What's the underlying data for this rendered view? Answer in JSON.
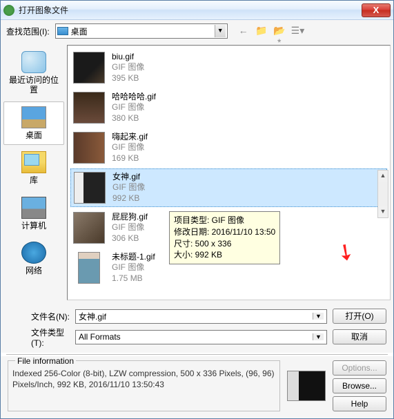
{
  "title": "打开图象文件",
  "toolbar": {
    "lookin_label": "查找范围(I):",
    "lookin_value": "桌面"
  },
  "nav": {
    "back": "←",
    "up": "📁",
    "newfolder": "📂*",
    "views": "☰▾"
  },
  "sidebar": {
    "items": [
      {
        "label": "最近访问的位置"
      },
      {
        "label": "桌面"
      },
      {
        "label": "库"
      },
      {
        "label": "计算机"
      },
      {
        "label": "网络"
      }
    ]
  },
  "files": [
    {
      "name": "biu.gif",
      "type": "GIF 图像",
      "size": "395 KB",
      "thumb": "th-biu"
    },
    {
      "name": "哈哈哈哈.gif",
      "type": "GIF 图像",
      "size": "380 KB",
      "thumb": "th-haha"
    },
    {
      "name": "嗨起来.gif",
      "type": "GIF 图像",
      "size": "169 KB",
      "thumb": "th-hai"
    },
    {
      "name": "女神.gif",
      "type": "GIF 图像",
      "size": "992 KB",
      "thumb": "th-nvshen",
      "selected": true
    },
    {
      "name": "屁屁狗.gif",
      "type": "GIF 图像",
      "size": "306 KB",
      "thumb": "th-pipi"
    },
    {
      "name": "未标题-1.gif",
      "type": "GIF 图像",
      "size": "1.75 MB",
      "thumb": "th-weibiao"
    }
  ],
  "tooltip": {
    "l1": "项目类型: GIF 图像",
    "l2": "修改日期: 2016/11/10 13:50",
    "l3": "尺寸: 500 x 336",
    "l4": "大小: 992 KB"
  },
  "form": {
    "filename_label": "文件名(N):",
    "filename_value": "女神.gif",
    "filetype_label": "文件类型(T):",
    "filetype_value": "All Formats",
    "open": "打开(O)",
    "cancel": "取消"
  },
  "fileinfo": {
    "legend": "File information",
    "text": "Indexed 256-Color (8-bit),  LZW compression,  500 x 336 Pixels,   (96, 96) Pixels/Inch,  992 KB,  2016/11/10 13:50:43"
  },
  "buttons": {
    "options": "Options...",
    "browse": "Browse...",
    "help": "Help"
  },
  "close_x": "X"
}
